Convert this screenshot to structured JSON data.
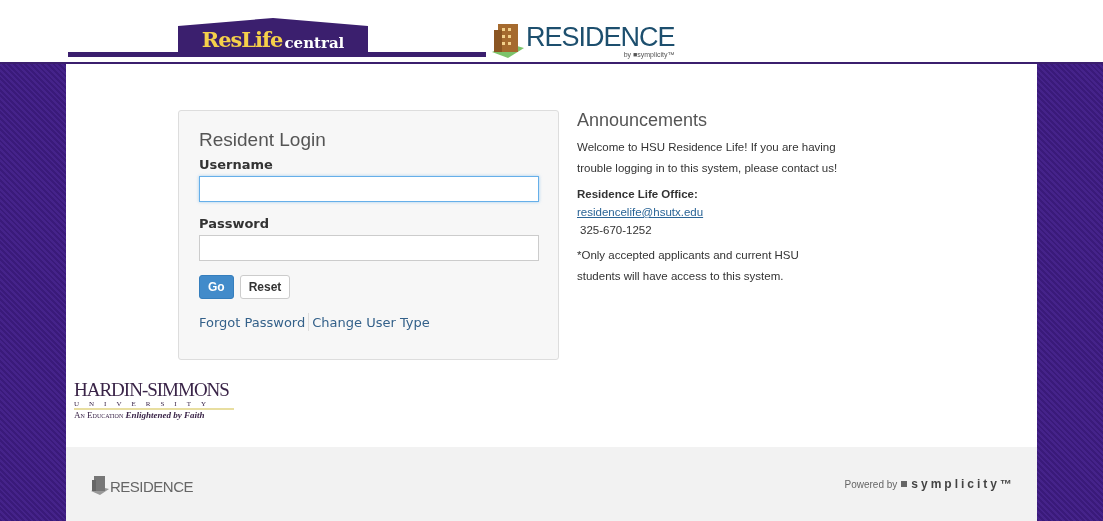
{
  "header": {
    "reslife_logo": {
      "word_1": "ResLife",
      "word_2": "central"
    },
    "residence_logo": {
      "name": "RESIDENCE",
      "byline": "by ■symplicity™"
    }
  },
  "login": {
    "title": "Resident Login",
    "fields": [
      {
        "label": "Username",
        "focused": true
      },
      {
        "label": "Password",
        "focused": false
      }
    ],
    "buttons": [
      {
        "label": "Go",
        "kind": "primary"
      },
      {
        "label": "Reset",
        "kind": "default"
      }
    ],
    "links": [
      "Forgot Password",
      "Change User Type"
    ]
  },
  "announcements": {
    "title": "Announcements",
    "welcome": "Welcome to HSU Residence Life! If you are having trouble logging in to this system, please contact us!",
    "office_heading": "Residence Life Office:",
    "email": "residencelife@hsutx.edu",
    "phone": "325-670-1252",
    "note": "*Only accepted applicants and current HSU students will have access to this system."
  },
  "university_logo": {
    "name": "HARDIN-SIMMONS",
    "subtitle": "UNIVERSITY",
    "tagline_1": "An Education",
    "tagline_2": "Enlightened by Faith"
  },
  "footer": {
    "logo": "RESIDENCE",
    "powered_by": "Powered by",
    "brand": "symplicity™"
  }
}
